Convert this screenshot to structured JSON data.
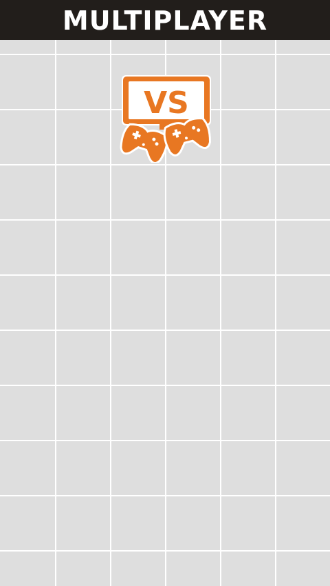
{
  "header": {
    "title": "MULTIPLAYER"
  },
  "mode_icon": {
    "name": "versus-gamepads-icon",
    "text": "VS",
    "color": "#e87722"
  },
  "colors": {
    "header_bg": "#221e1b",
    "cell_bg": "#dedede",
    "grid_lines": "#ffffff",
    "accent": "#e87722"
  }
}
